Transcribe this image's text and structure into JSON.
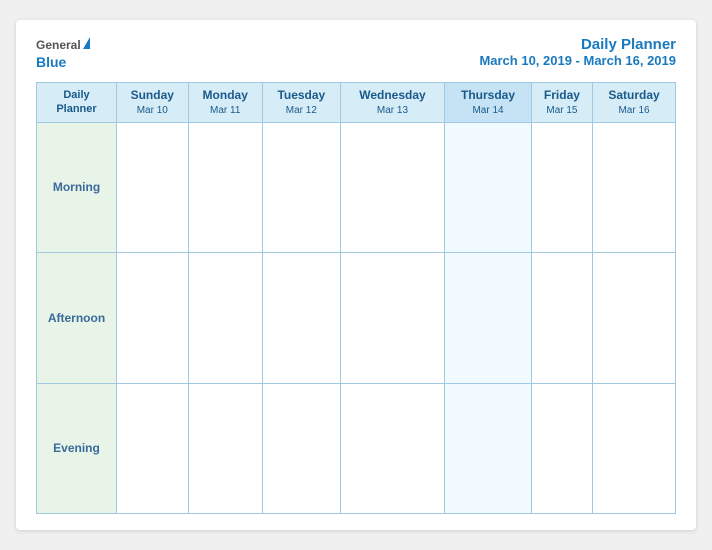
{
  "header": {
    "logo_general": "General",
    "logo_blue": "Blue",
    "title_main": "Daily Planner",
    "title_sub": "March 10, 2019 - March 16, 2019"
  },
  "columns": {
    "label": {
      "line1": "Daily",
      "line2": "Planner"
    },
    "days": [
      {
        "name": "Sunday",
        "date": "Mar 10"
      },
      {
        "name": "Monday",
        "date": "Mar 11"
      },
      {
        "name": "Tuesday",
        "date": "Mar 12"
      },
      {
        "name": "Wednesday",
        "date": "Mar 13"
      },
      {
        "name": "Thursday",
        "date": "Mar 14"
      },
      {
        "name": "Friday",
        "date": "Mar 15"
      },
      {
        "name": "Saturday",
        "date": "Mar 16"
      }
    ]
  },
  "rows": [
    {
      "label": "Morning"
    },
    {
      "label": "Afternoon"
    },
    {
      "label": "Evening"
    }
  ]
}
